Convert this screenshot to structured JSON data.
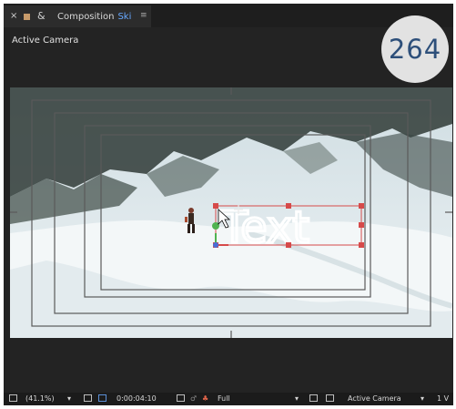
{
  "tab": {
    "close_glyph": "×",
    "lock_glyph": "&",
    "title": "Composition",
    "comp_name": "Ski",
    "menu_glyph": "≡"
  },
  "viewer": {
    "camera_label": "Active Camera"
  },
  "badge": {
    "number": "264"
  },
  "layer": {
    "text": "Text"
  },
  "statusbar": {
    "zoom": "(41.1%)",
    "timecode": "0:00:04:10",
    "resolution": "Full",
    "camera_view": "Active Camera",
    "views": "1 V"
  },
  "colors": {
    "panel_bg": "#232323",
    "accent_blue": "#66a8ff",
    "handle_red": "#d64a4a",
    "badge_bg": "#e2e2e2",
    "badge_text": "#2d4f7a"
  }
}
